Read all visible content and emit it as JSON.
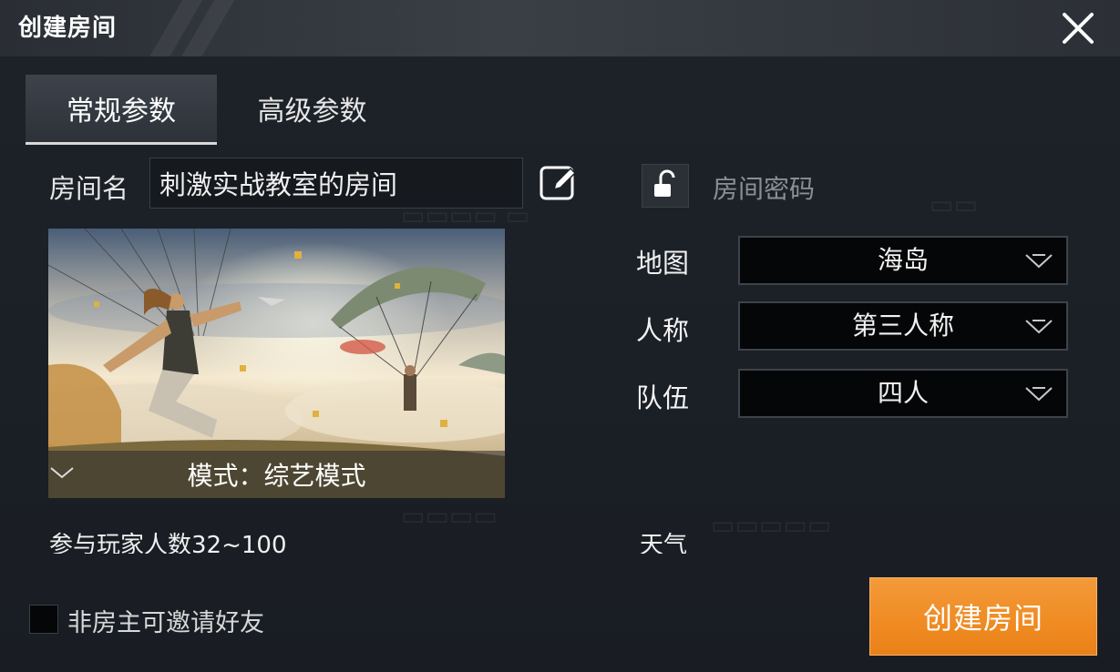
{
  "header": {
    "title": "创建房间",
    "close_icon": "close-icon"
  },
  "tabs": [
    {
      "label": "常规参数",
      "active": true
    },
    {
      "label": "高级参数",
      "active": false
    }
  ],
  "room": {
    "name_label": "房间名",
    "name_value": "刺激实战教室的房间",
    "edit_icon": "edit-icon",
    "lock_icon": "unlock-icon",
    "password_label": "房间密码"
  },
  "mode": {
    "label": "模式：综艺模式",
    "image": "parachute-skydiving-artwork"
  },
  "settings": {
    "map": {
      "label": "地图",
      "value": "海岛"
    },
    "perspective": {
      "label": "人称",
      "value": "第三人称"
    },
    "team": {
      "label": "队伍",
      "value": "四人"
    }
  },
  "players_label": "参与玩家人数32~100",
  "weather_label": "天气",
  "invite": {
    "label": "非房主可邀请好友",
    "checked": false
  },
  "create_button": "创建房间",
  "colors": {
    "accent": "#ef8b22",
    "background": "#1c2128",
    "header": "#33383f"
  }
}
